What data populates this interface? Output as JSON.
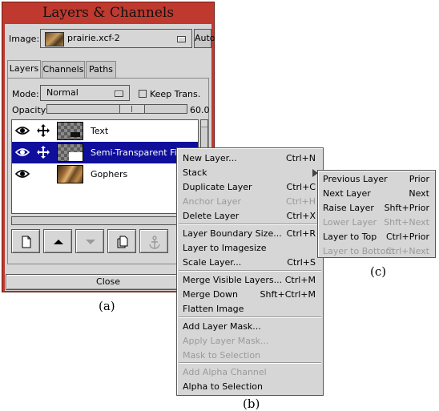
{
  "window": {
    "title": "Layers & Channels",
    "image_label": "Image:",
    "image_value": "prairie.xcf-2",
    "auto_label": "Auto",
    "tabs": [
      {
        "label": "Layers",
        "active": true
      },
      {
        "label": "Channels",
        "active": false
      },
      {
        "label": "Paths",
        "active": false
      }
    ],
    "mode_label": "Mode:",
    "mode_value": "Normal",
    "keep_trans_label": "Keep Trans.",
    "opacity_label": "Opacity:",
    "opacity_value": "60.0",
    "opacity_fraction": 0.6,
    "layers": [
      {
        "name": "Text",
        "selected": false,
        "thumb": "checker-text"
      },
      {
        "name": "Semi-Transparent Film",
        "selected": true,
        "thumb": "checker-partial"
      },
      {
        "name": "Gophers",
        "selected": false,
        "thumb": "photo"
      }
    ],
    "toolbar_icons": [
      "new-layer-icon",
      "raise-layer-icon",
      "lower-layer-icon",
      "duplicate-layer-icon",
      "anchor-icon"
    ],
    "close_label": "Close"
  },
  "labels": {
    "a": "(a)",
    "b": "(b)",
    "c": "(c)"
  },
  "menu": {
    "items": [
      {
        "label": "New Layer...",
        "accel": "Ctrl+N",
        "disabled": false
      },
      {
        "label": "Stack",
        "accel": "",
        "disabled": false,
        "submenu": true
      },
      {
        "label": "Duplicate Layer",
        "accel": "Ctrl+C",
        "disabled": false
      },
      {
        "label": "Anchor Layer",
        "accel": "Ctrl+H",
        "disabled": true
      },
      {
        "label": "Delete Layer",
        "accel": "Ctrl+X",
        "disabled": false
      },
      {
        "label": "Layer Boundary Size...",
        "accel": "Ctrl+R",
        "disabled": false
      },
      {
        "label": "Layer to Imagesize",
        "accel": "",
        "disabled": false
      },
      {
        "label": "Scale Layer...",
        "accel": "Ctrl+S",
        "disabled": false
      },
      {
        "label": "Merge Visible Layers...",
        "accel": "Ctrl+M",
        "disabled": false
      },
      {
        "label": "Merge Down",
        "accel": "Shft+Ctrl+M",
        "disabled": false
      },
      {
        "label": "Flatten Image",
        "accel": "",
        "disabled": false
      },
      {
        "label": "Add Layer Mask...",
        "accel": "",
        "disabled": false
      },
      {
        "label": "Apply Layer Mask...",
        "accel": "",
        "disabled": true
      },
      {
        "label": "Mask to Selection",
        "accel": "",
        "disabled": true
      },
      {
        "label": "Add Alpha Channel",
        "accel": "",
        "disabled": true
      },
      {
        "label": "Alpha to Selection",
        "accel": "",
        "disabled": false
      }
    ]
  },
  "submenu": {
    "items": [
      {
        "label": "Previous Layer",
        "accel": "Prior",
        "disabled": false
      },
      {
        "label": "Next Layer",
        "accel": "Next",
        "disabled": false
      },
      {
        "label": "Raise Layer",
        "accel": "Shft+Prior",
        "disabled": false
      },
      {
        "label": "Lower Layer",
        "accel": "Shft+Next",
        "disabled": true
      },
      {
        "label": "Layer to Top",
        "accel": "Ctrl+Prior",
        "disabled": false
      },
      {
        "label": "Layer to Bottom",
        "accel": "Ctrl+Next",
        "disabled": true
      }
    ]
  },
  "colors": {
    "title_bar": "#c0392f",
    "selection": "#0f0f9c",
    "panel": "#d6d6d6",
    "disabled_text": "#9a9a9a"
  }
}
